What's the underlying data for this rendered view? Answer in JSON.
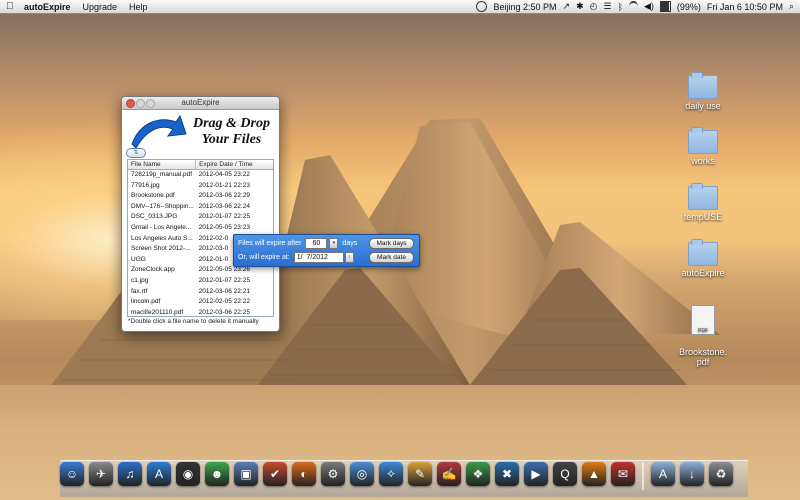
{
  "menubar": {
    "app_name": "autoExpire",
    "menus": [
      "Upgrade",
      "Help"
    ],
    "clock_location": "Beijing 2:50 PM",
    "battery": "(99%)",
    "datetime": "Fri Jan 6  10:50 PM"
  },
  "desktop_icons": [
    {
      "label": "daily use",
      "kind": "folder"
    },
    {
      "label": "works",
      "kind": "folder"
    },
    {
      "label": "tempUSE",
      "kind": "folder"
    },
    {
      "label": "autoExpire",
      "kind": "folder"
    },
    {
      "label": "Brookstone.\npdf",
      "kind": "pdf"
    }
  ],
  "window": {
    "title": "autoExpire",
    "drop_title_line1": "Drag & Drop",
    "drop_title_line2": "Your Files",
    "sort_button": "⇅",
    "columns": [
      "File Name",
      "Expire Date / Time"
    ],
    "files": [
      {
        "name": "728219p_manual.pdf",
        "expire": "2012-04-05 23:22"
      },
      {
        "name": "77916.jpg",
        "expire": "2012-01-21 22:23"
      },
      {
        "name": "Brookstone.pdf",
        "expire": "2012-03-06 22:29"
      },
      {
        "name": "DMV--176--Shoppin...",
        "expire": "2012-03-06 22:24"
      },
      {
        "name": "DSC_0313.JPG",
        "expire": "2012-01-07 22:25"
      },
      {
        "name": "Gmail - Los Angele...",
        "expire": "2012-05-05 23:23"
      },
      {
        "name": "Los Angeles Auto S...",
        "expire": "2012-02-0"
      },
      {
        "name": "Screen Shot 2012-...",
        "expire": "2012-03-0"
      },
      {
        "name": "UGG",
        "expire": "2012-01-0"
      },
      {
        "name": "ZoneClock.app",
        "expire": "2012-05-05 23:26"
      },
      {
        "name": "c1.jpg",
        "expire": "2012-01-07 22:25"
      },
      {
        "name": "fax.rtf",
        "expire": "2012-03-06 22:21"
      },
      {
        "name": "lincoln.pdf",
        "expire": "2012-02-05 22:22"
      },
      {
        "name": "maclife201110.pdf",
        "expire": "2012-03-06 22:25"
      }
    ],
    "footnote": "*Double click a file name to delete it manually"
  },
  "popup": {
    "row1_label": "Files will expire after",
    "days_value": "60",
    "days_unit": "days",
    "mark_days_button": "Mark days",
    "row2_label": "Or,  will expire at:",
    "date_value": "1/  7/2012",
    "mark_date_button": "Mark date"
  },
  "dock": {
    "apps": [
      {
        "name": "finder",
        "glyph": "☺",
        "color": "#3a7bd5"
      },
      {
        "name": "rocket",
        "glyph": "✈",
        "color": "#8a8a8a"
      },
      {
        "name": "itunes",
        "glyph": "♫",
        "color": "#2d6fc9"
      },
      {
        "name": "app-store",
        "glyph": "A",
        "color": "#2a7fd8"
      },
      {
        "name": "dashboard",
        "glyph": "◉",
        "color": "#333333"
      },
      {
        "name": "messenger",
        "glyph": "☻",
        "color": "#3fa64a"
      },
      {
        "name": "preview",
        "glyph": "▣",
        "color": "#5d7db5"
      },
      {
        "name": "activity",
        "glyph": "✔",
        "color": "#c84a2b"
      },
      {
        "name": "firefox",
        "glyph": "◐",
        "color": "#e06a1b"
      },
      {
        "name": "settings",
        "glyph": "⚙",
        "color": "#7a7a7a"
      },
      {
        "name": "chrome",
        "glyph": "◎",
        "color": "#4a8fd3"
      },
      {
        "name": "safari",
        "glyph": "✧",
        "color": "#3c8ad8"
      },
      {
        "name": "paint",
        "glyph": "✎",
        "color": "#d9a13a"
      },
      {
        "name": "texteditor",
        "glyph": "✍",
        "color": "#b23a3a"
      },
      {
        "name": "network",
        "glyph": "❖",
        "color": "#3a9b4a"
      },
      {
        "name": "xcode",
        "glyph": "✖",
        "color": "#2b6ea8"
      },
      {
        "name": "imovie",
        "glyph": "▶",
        "color": "#3b6fb0"
      },
      {
        "name": "quicktime",
        "glyph": "Q",
        "color": "#444444"
      },
      {
        "name": "vlc",
        "glyph": "▲",
        "color": "#e07b12"
      },
      {
        "name": "calendar",
        "glyph": "✉",
        "color": "#c03030"
      }
    ],
    "stack_items": [
      {
        "name": "applications",
        "glyph": "A",
        "color": "#8fb0d8"
      },
      {
        "name": "downloads",
        "glyph": "↓",
        "color": "#8fb0d8"
      },
      {
        "name": "trash",
        "glyph": "♻",
        "color": "#8a8f96"
      }
    ]
  }
}
